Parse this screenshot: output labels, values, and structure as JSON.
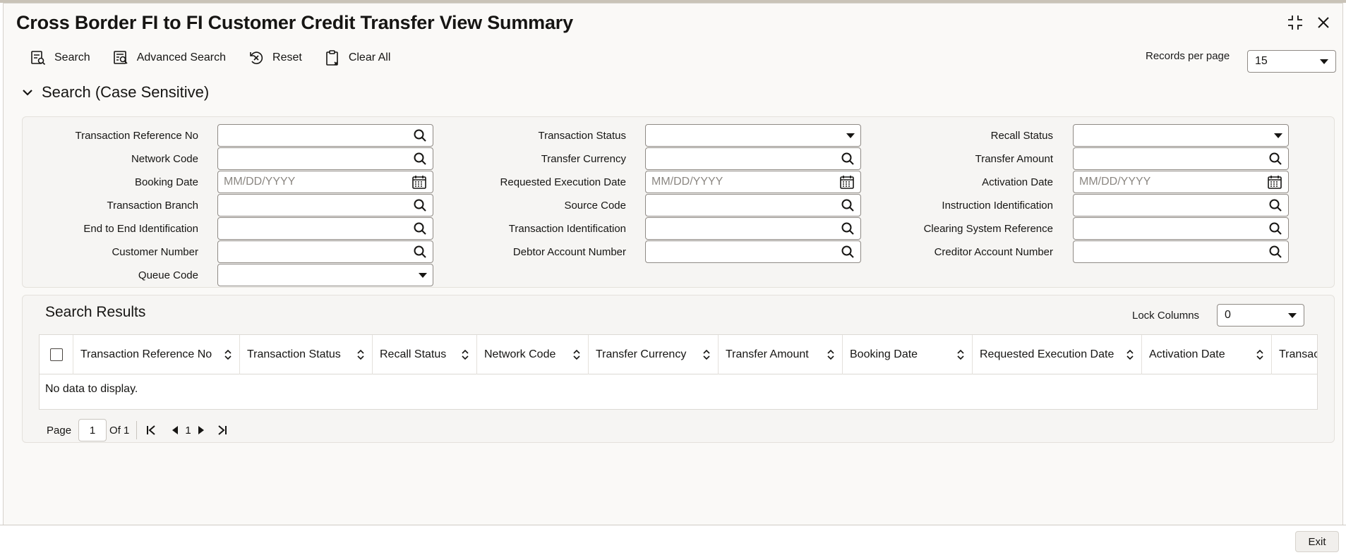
{
  "window": {
    "title": "Cross Border FI to FI Customer Credit Transfer View Summary"
  },
  "toolbar": {
    "search": "Search",
    "advanced_search": "Advanced Search",
    "reset": "Reset",
    "clear_all": "Clear All"
  },
  "records_per_page": {
    "label": "Records per page",
    "value": "15"
  },
  "search_section": {
    "title": "Search (Case Sensitive)"
  },
  "fields": {
    "transaction_reference_no": "Transaction Reference No",
    "transaction_status": "Transaction Status",
    "recall_status": "Recall Status",
    "network_code": "Network Code",
    "transfer_currency": "Transfer Currency",
    "transfer_amount": "Transfer Amount",
    "booking_date": "Booking Date",
    "requested_execution_date": "Requested Execution Date",
    "activation_date": "Activation Date",
    "transaction_branch": "Transaction Branch",
    "source_code": "Source Code",
    "instruction_identification": "Instruction Identification",
    "end_to_end_identification": "End to End Identification",
    "transaction_identification": "Transaction Identification",
    "clearing_system_reference": "Clearing System Reference",
    "customer_number": "Customer Number",
    "debtor_account_number": "Debtor Account Number",
    "creditor_account_number": "Creditor Account Number",
    "queue_code": "Queue Code",
    "date_placeholder": "MM/DD/YYYY"
  },
  "results": {
    "title": "Search Results",
    "lock_columns_label": "Lock Columns",
    "lock_columns_value": "0",
    "columns": [
      "Transaction Reference No",
      "Transaction Status",
      "Recall Status",
      "Network Code",
      "Transfer Currency",
      "Transfer Amount",
      "Booking Date",
      "Requested Execution Date",
      "Activation Date",
      "Transacti"
    ],
    "empty_text": "No data to display."
  },
  "pager": {
    "page_label": "Page",
    "page_value": "1",
    "of_label": "Of 1",
    "current": "1"
  },
  "footer": {
    "exit": "Exit"
  },
  "icons": {
    "search": "search-icon",
    "calendar": "calendar-icon",
    "dropdown": "chevron-down-icon",
    "sort": "sort-icon"
  }
}
